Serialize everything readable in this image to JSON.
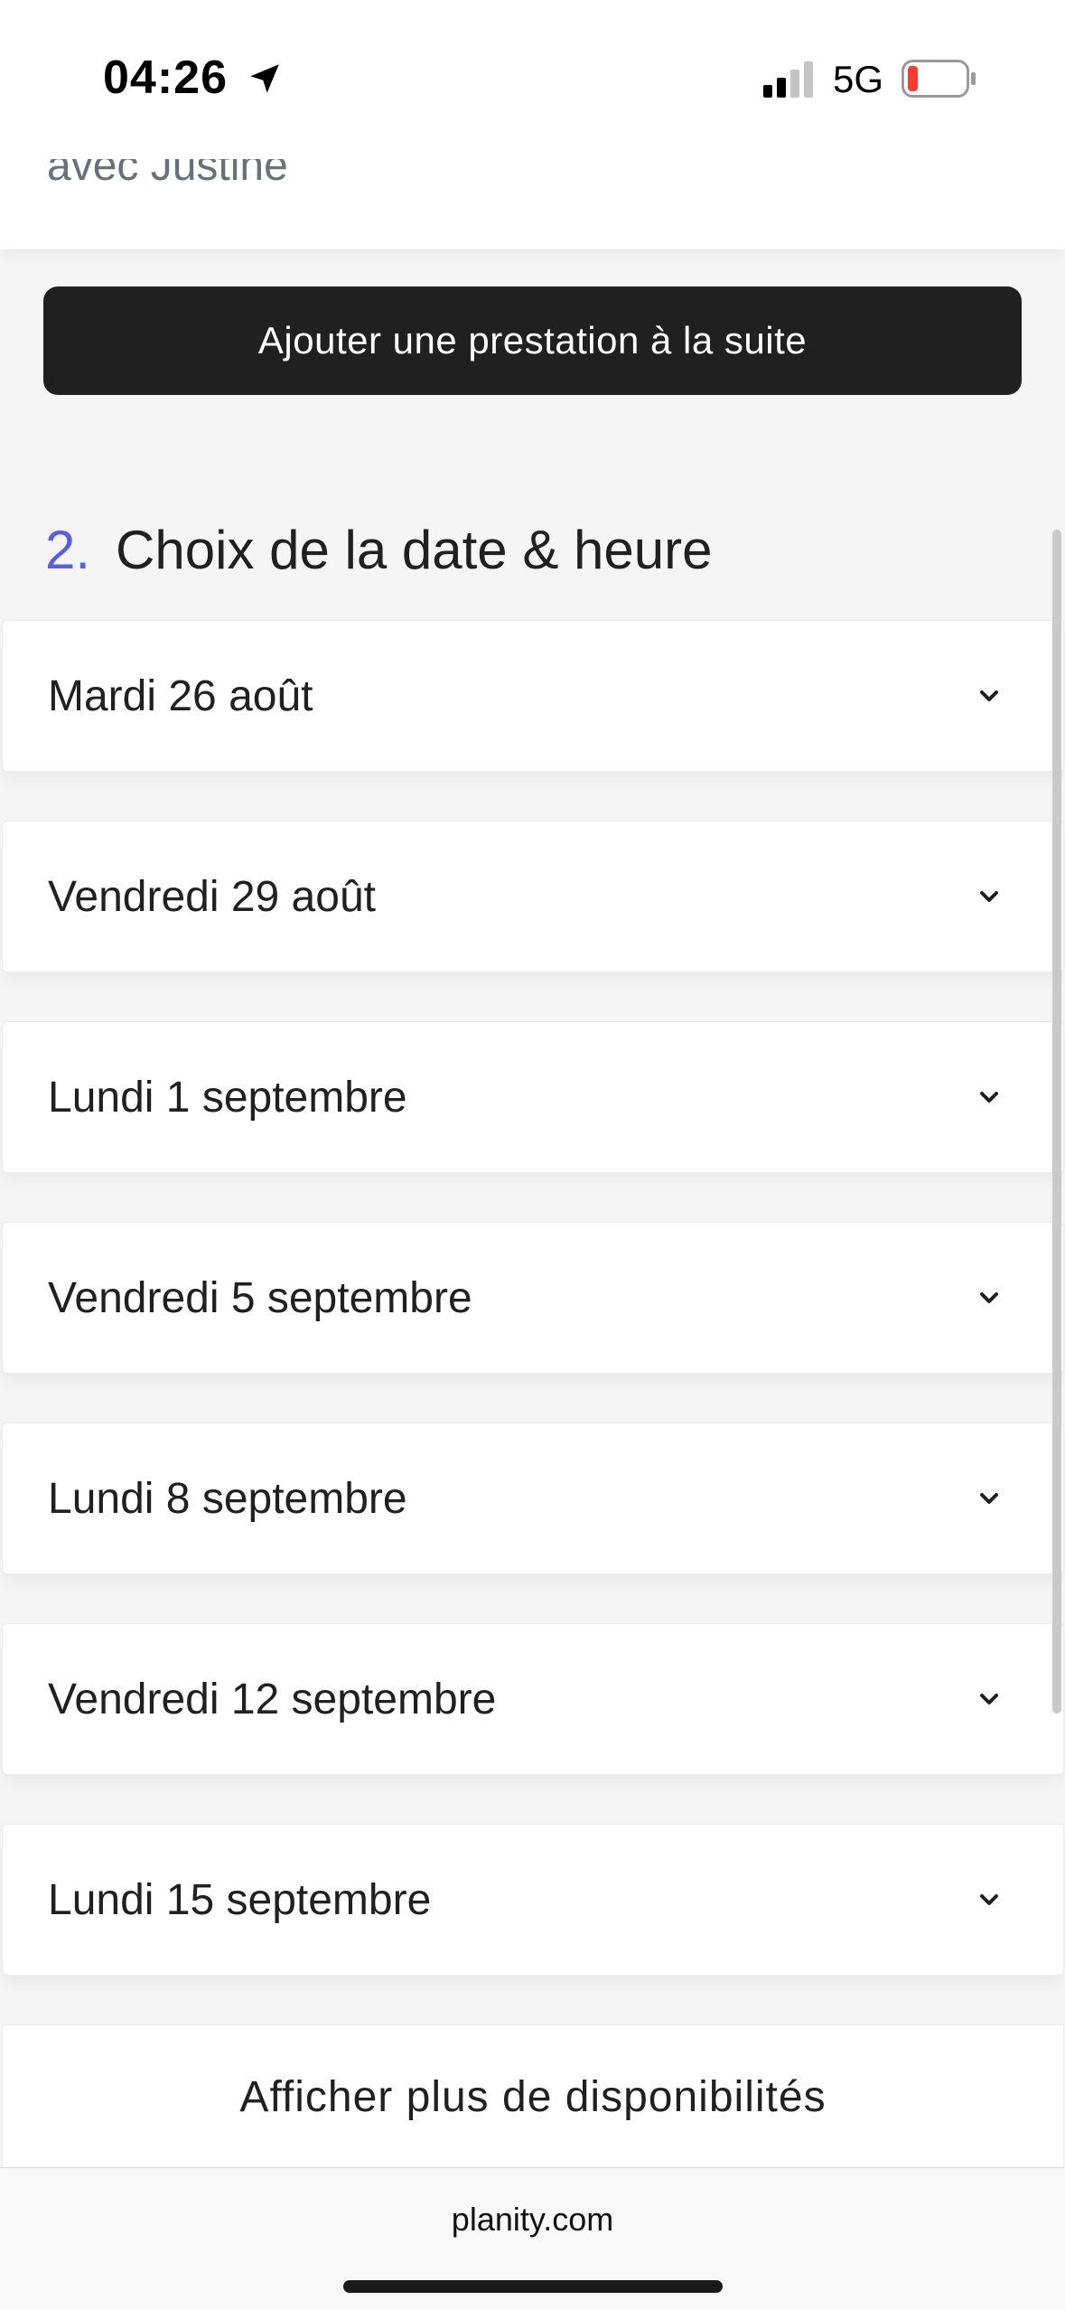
{
  "status_bar": {
    "time": "04:26",
    "network": "5G",
    "icons": [
      "location-arrow-icon",
      "cellular-signal-icon",
      "battery-low-icon"
    ],
    "battery_color": "#ff3b30"
  },
  "previous_section": {
    "partial_text": "avec Justine"
  },
  "add_service": {
    "label": "Ajouter une prestation à la suite"
  },
  "section": {
    "number": "2.",
    "title": "Choix de la date & heure",
    "number_color": "#5b5be6"
  },
  "dates": [
    {
      "label": "Mardi 26 août",
      "icon": "chevron-down-icon"
    },
    {
      "label": "Vendredi 29 août",
      "icon": "chevron-down-icon"
    },
    {
      "label": "Lundi 1 septembre",
      "icon": "chevron-down-icon"
    },
    {
      "label": "Vendredi 5 septembre",
      "icon": "chevron-down-icon"
    },
    {
      "label": "Lundi 8 septembre",
      "icon": "chevron-down-icon"
    },
    {
      "label": "Vendredi 12 septembre",
      "icon": "chevron-down-icon"
    },
    {
      "label": "Lundi 15 septembre",
      "icon": "chevron-down-icon"
    }
  ],
  "show_more": {
    "label": "Afficher plus de disponibilités"
  },
  "browser": {
    "url": "planity.com"
  }
}
